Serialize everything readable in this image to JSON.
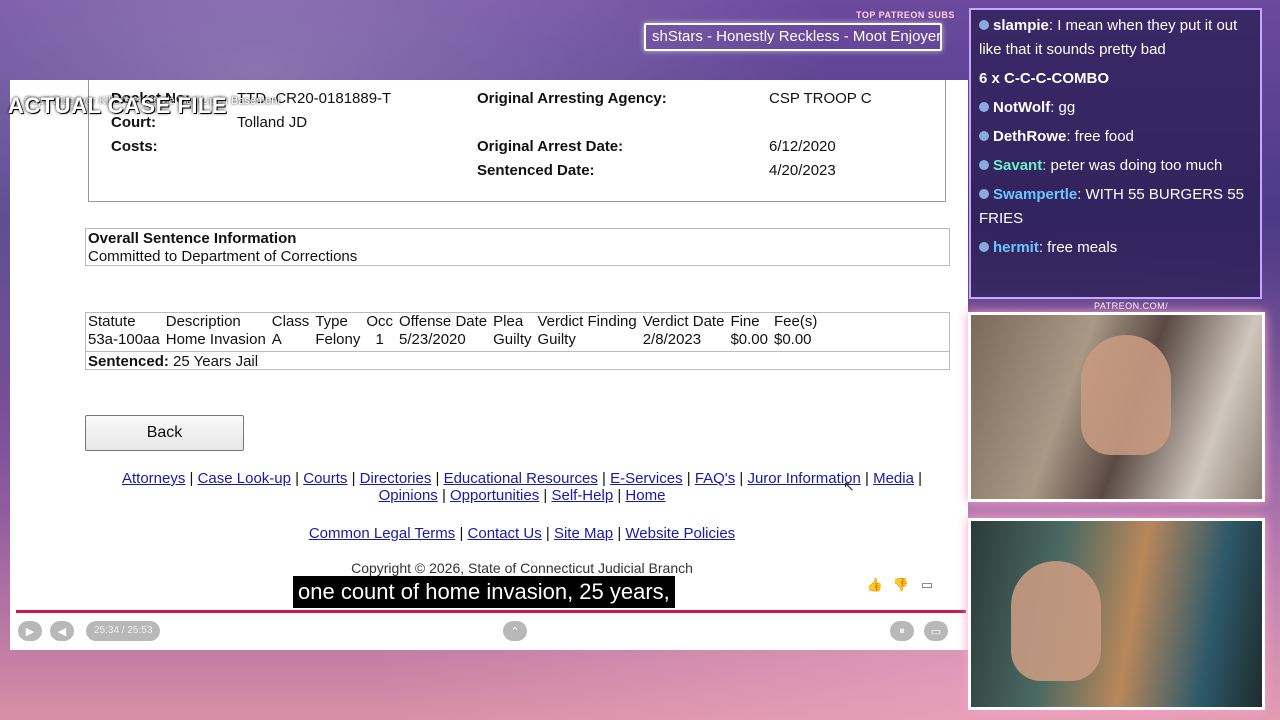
{
  "overlay": {
    "title": "ACTUAL CASE FILE",
    "video_title": "Cops Discover Killer's Hostage Tied Up In Basement",
    "marquee_label": "TOP PATREON SUBS",
    "marquee_text": "shStars - Honestly Reckless - Moot Enjoyer",
    "patreon_label": "PATREON.COM/",
    "caption": "one count of home invasion, 25 years,"
  },
  "case": {
    "docket_label": "Docket No:",
    "docket_value": "TTD -CR20-0181889-T",
    "court_label": "Court:",
    "court_value": "Tolland JD",
    "costs_label": "Costs:",
    "agency_label": "Original Arresting Agency:",
    "agency_value": "CSP TROOP C",
    "arrest_date_label": "Original Arrest Date:",
    "arrest_date_value": "6/12/2020",
    "sentenced_date_label": "Sentenced Date:",
    "sentenced_date_value": "4/20/2023"
  },
  "sentence": {
    "heading": "Overall Sentence Information",
    "text": "Committed to Department of Corrections"
  },
  "charges": {
    "headers": [
      "Statute",
      "Description",
      "Class",
      "Type",
      "Occ",
      "Offense Date",
      "Plea",
      "Verdict Finding",
      "Verdict Date",
      "Fine",
      "Fee(s)"
    ],
    "row": [
      "53a-100aa",
      "Home Invasion",
      "A",
      "Felony",
      "1",
      "5/23/2020",
      "Guilty",
      "Guilty",
      "2/8/2023",
      "$0.00",
      "$0.00"
    ],
    "sentenced_label": "Sentenced:",
    "sentenced_value": "25 Years Jail"
  },
  "back_label": "Back",
  "footer": {
    "links1": [
      "Attorneys",
      "Case Look-up",
      "Courts",
      "Directories",
      "Educational Resources",
      "E-Services",
      "FAQ's",
      "Juror Information",
      "Media",
      "Opinions",
      "Opportunities",
      "Self-Help",
      "Home"
    ],
    "links2": [
      "Common Legal Terms",
      "Contact Us",
      "Site Map",
      "Website Policies"
    ],
    "copyright": "Copyright © 2026, State of Connecticut Judicial Branch"
  },
  "player": {
    "time": "25:34 / 25:53"
  },
  "chat": [
    {
      "name": "slampie",
      "text": ": I mean when they put it out like that it sounds pretty bad",
      "color": "#ffffff"
    },
    {
      "name": "",
      "text": "6 x C-C-C-COMBO",
      "color": "#ffffff"
    },
    {
      "name": "NotWolf",
      "text": ": gg",
      "color": "#ffffff"
    },
    {
      "name": "DethRowe",
      "text": ": free food",
      "color": "#ffffff"
    },
    {
      "name": "Savant",
      "text": ": peter was doing too much",
      "color": "#6cf0c8"
    },
    {
      "name": "Swampertle",
      "text": ": WITH 55 BURGERS 55 FRIES",
      "color": "#6cc6ff"
    },
    {
      "name": "hermit",
      "text": ": free meals",
      "color": "#6cc6ff"
    }
  ]
}
